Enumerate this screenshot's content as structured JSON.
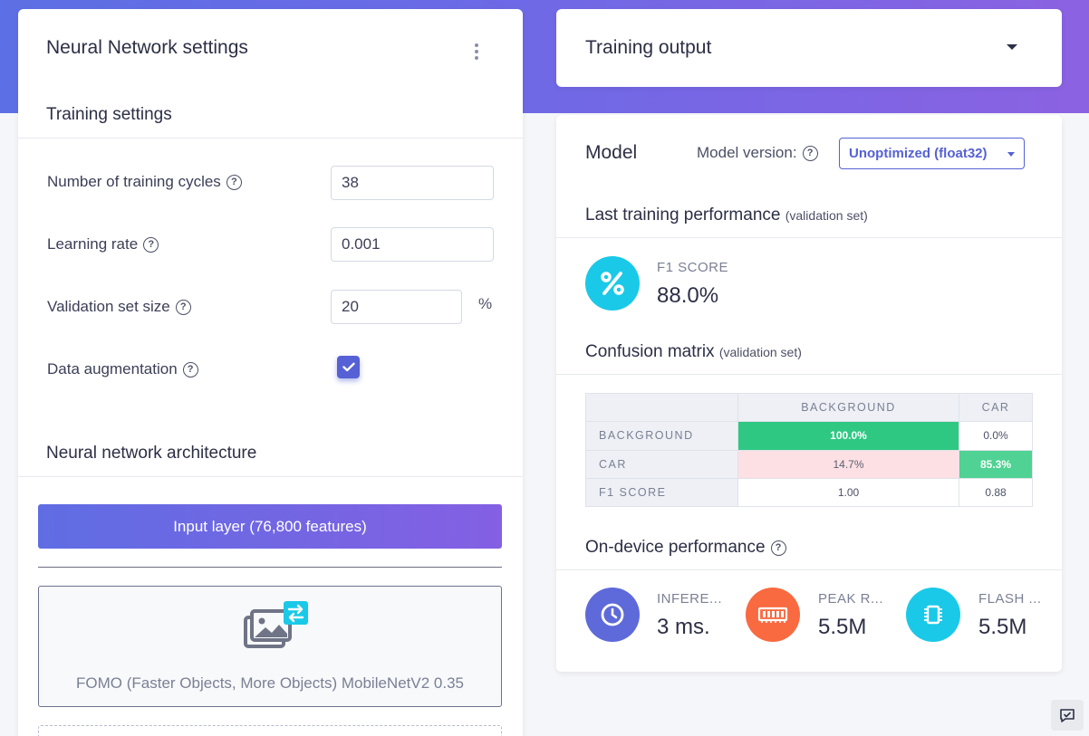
{
  "colors": {
    "accent": "#5561d5",
    "band_start": "#5d6fe4",
    "band_end": "#8b62e2",
    "green": "#2ec882",
    "pink": "#fde0e3",
    "teal": "#1ac9e7",
    "orange": "#f96a41",
    "indigo": "#5e6ad9"
  },
  "nn_settings": {
    "title": "Neural Network settings",
    "menu_icon": "kebab-vertical-icon",
    "training_settings_title": "Training settings",
    "fields": [
      {
        "label": "Number of training cycles",
        "value": "38"
      },
      {
        "label": "Learning rate",
        "value": "0.001"
      },
      {
        "label": "Validation set size",
        "value": "20",
        "unit": "%"
      },
      {
        "label": "Data augmentation",
        "checked": true
      }
    ],
    "architecture_title": "Neural network architecture",
    "input_layer_label": "Input layer (76,800 features)",
    "model_block_label": "FOMO (Faster Objects, More Objects) MobileNetV2 0.35",
    "model_block_icon": "image-swap-icon"
  },
  "training_output": {
    "title": "Training output"
  },
  "model": {
    "title": "Model",
    "version_label": "Model version:",
    "version_value": "Unoptimized (float32)",
    "last_perf_title": "Last training performance",
    "last_perf_note": "(validation set)",
    "f1_label": "F1 SCORE",
    "f1_value": "88.0%",
    "f1_icon": "percent-icon",
    "cm_title": "Confusion matrix",
    "cm_note": "(validation set)",
    "cm_columns": [
      "BACKGROUND",
      "CAR"
    ],
    "cm_rows": [
      {
        "label": "BACKGROUND",
        "cells": [
          "100.0%",
          "0.0%"
        ]
      },
      {
        "label": "CAR",
        "cells": [
          "14.7%",
          "85.3%"
        ]
      },
      {
        "label": "F1 SCORE",
        "cells": [
          "1.00",
          "0.88"
        ]
      }
    ],
    "ondevice_title": "On-device performance",
    "metrics": [
      {
        "label": "INFERE...",
        "value": "3 ms.",
        "icon": "clock-icon"
      },
      {
        "label": "PEAK R...",
        "value": "5.5M",
        "icon": "ram-icon"
      },
      {
        "label": "FLASH ...",
        "value": "5.5M",
        "icon": "chip-icon"
      }
    ]
  },
  "feedback_icon": "feedback-icon"
}
